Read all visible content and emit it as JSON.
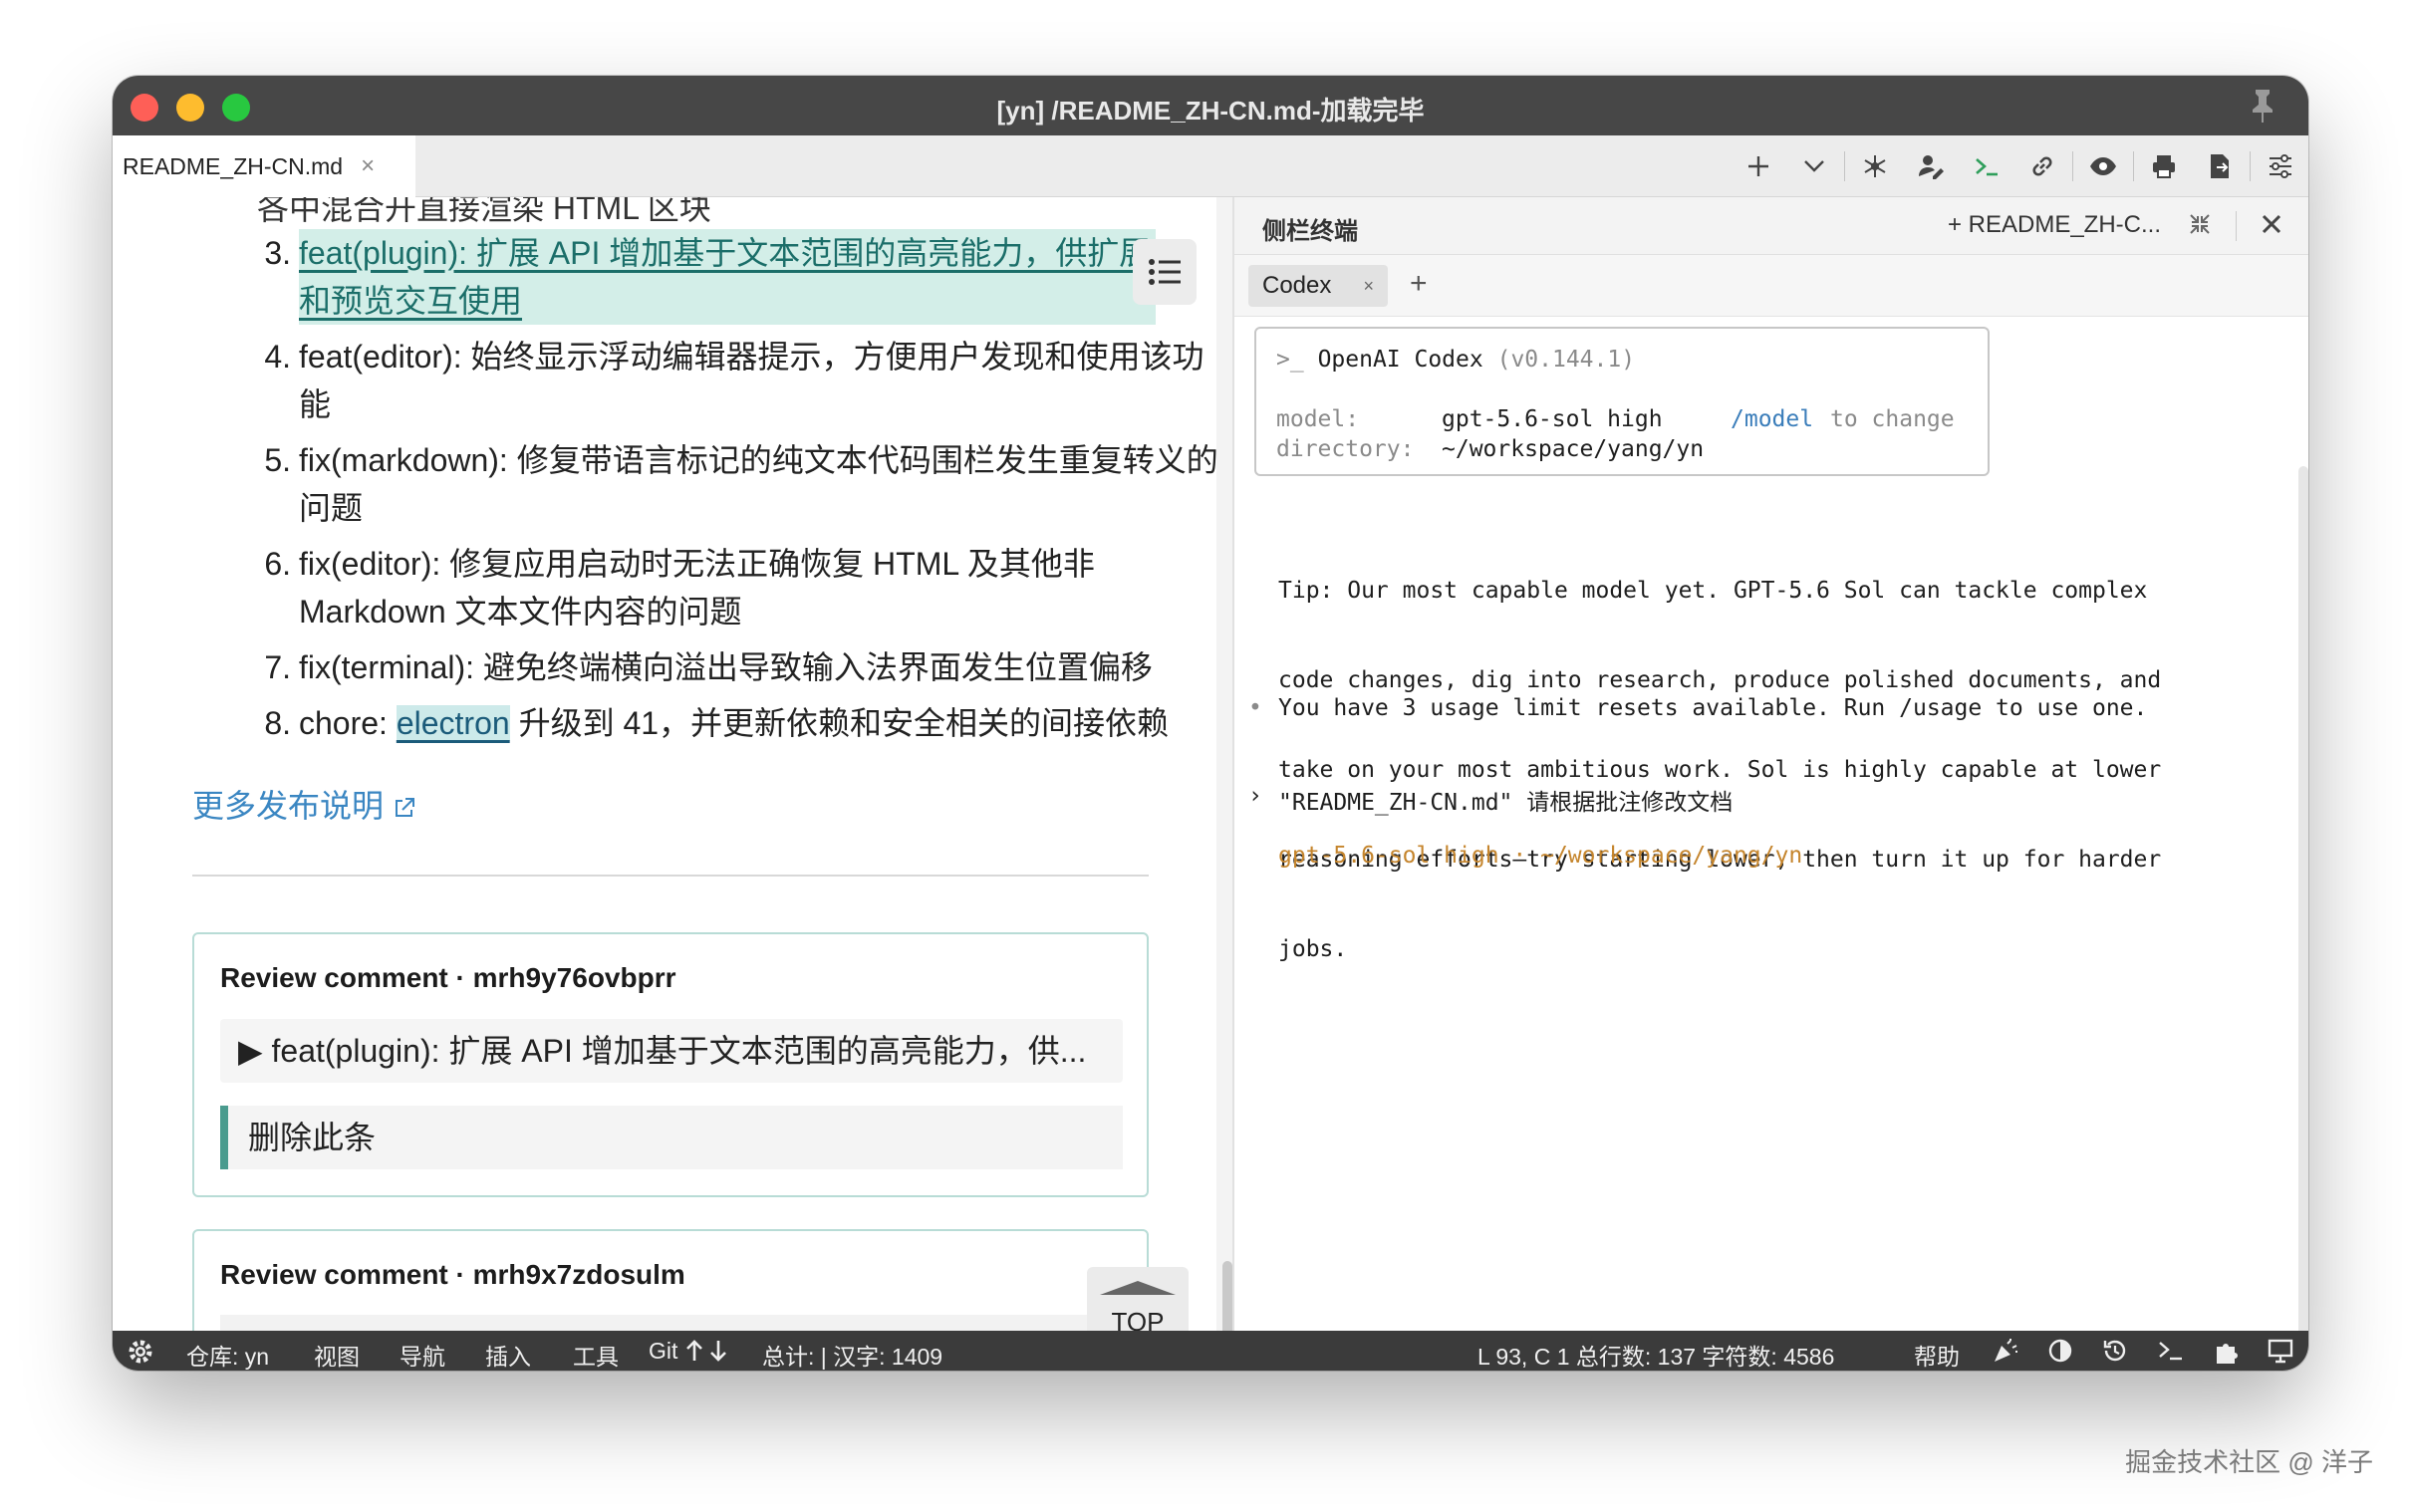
{
  "window": {
    "title": "[yn] /README_ZH-CN.md-加载完毕"
  },
  "tab": {
    "name": "README_ZH-CN.md",
    "close": "×"
  },
  "editor": {
    "cut_line": "各中混合开直接渲染 HTML 区块",
    "items": [
      {
        "num": "3.",
        "prefix": "",
        "link": "feat(plugin): 扩展 API 增加基于文本范围的高亮能力，供扩展和预览交互使用",
        "rest": ""
      },
      {
        "num": "4.",
        "text": "feat(editor): 始终显示浮动编辑器提示，方便用户发现和使用该功能"
      },
      {
        "num": "5.",
        "text": "fix(markdown): 修复带语言标记的纯文本代码围栏发生重复转义的问题"
      },
      {
        "num": "6.",
        "text": "fix(editor): 修复应用启动时无法正确恢复 HTML 及其他非 Markdown 文本文件内容的问题"
      },
      {
        "num": "7.",
        "text": "fix(terminal): 避免终端横向溢出导致输入法界面发生位置偏移"
      },
      {
        "num": "8.",
        "prefix": "chore: ",
        "link": "electron",
        "rest": " 升级到 41，并更新依赖和安全相关的间接依赖"
      }
    ],
    "more_link": "更多发布说明",
    "reviews": [
      {
        "title": "Review comment · mrh9y76ovbprr",
        "quote": "▶ feat(plugin): 扩展 API 增加基于文本范围的高亮能力，供...",
        "note": "删除此条"
      },
      {
        "title": "Review comment · mrh9x7zdosulm"
      }
    ],
    "top_button": "TOP"
  },
  "panel": {
    "title": "侧栏终端",
    "new_tab": "+ README_ZH-C...",
    "tab": "Codex",
    "tab_close": "×",
    "add": "+"
  },
  "terminal": {
    "prompt": ">_",
    "app_name": "OpenAI Codex",
    "version": "(v0.144.1)",
    "model_label": "model:",
    "model_value": "gpt-5.6-sol high",
    "model_cmd": "/model",
    "model_hint": "to change",
    "dir_label": "directory:",
    "dir_value": "~/workspace/yang/yn",
    "tip_lines": [
      "Tip: Our most capable model yet. GPT-5.6 Sol can tackle complex",
      "code changes, dig into research, produce polished documents, and",
      "take on your most ambitious work. Sol is highly capable at lower",
      "reasoning efforts—try starting lower, then turn it up for harder",
      "jobs."
    ],
    "bullet": "•",
    "usage_line": "You have 3 usage limit resets available. Run /usage to use one.",
    "input_marker": "›",
    "input_text": "\"README_ZH-CN.md\" 请根据批注修改文档",
    "status_line": "gpt-5.6-sol high · ~/workspace/yang/yn"
  },
  "statusbar": {
    "repo": "仓库: yn",
    "view": "视图",
    "nav": "导航",
    "insert": "插入",
    "tools": "工具",
    "git": "Git",
    "total": "总计: | 汉字: 1409",
    "position": "L 93, C 1 总行数: 137 字符数: 4586",
    "help": "帮助"
  },
  "watermark": "掘金技术社区 @ 洋子",
  "colors": {
    "titlebar": "#474747",
    "statusbar": "#3b3b3b",
    "highlight": "#d3eee8",
    "accent": "#4a9b8e",
    "link": "#3a86c2"
  }
}
